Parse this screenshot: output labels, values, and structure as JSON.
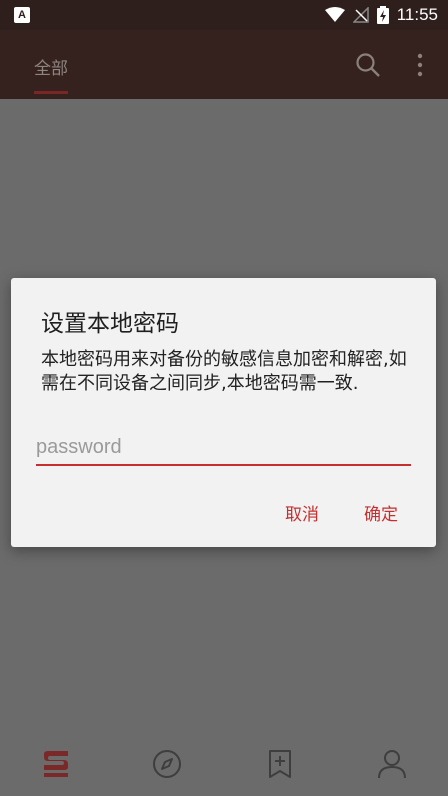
{
  "status_bar": {
    "app_icon_letter": "A",
    "time": "11:55",
    "icons": [
      "wifi-icon",
      "no-signal-icon",
      "battery-charging-icon"
    ]
  },
  "app_bar": {
    "tab_label": "全部",
    "icons": [
      "search-icon",
      "more-vert-icon"
    ]
  },
  "dialog": {
    "title": "设置本地密码",
    "message": "本地密码用来对备份的敏感信息加密和解密,如需在不同设备之间同步,本地密码需一致.",
    "input_placeholder": "password",
    "input_value": "",
    "cancel_label": "取消",
    "ok_label": "确定"
  },
  "bottom_nav": {
    "items": [
      "subscriptions-icon",
      "compass-icon",
      "bookmark-add-icon",
      "profile-icon"
    ]
  },
  "colors": {
    "accent": "#c62f2f",
    "app_bar": "#35221e",
    "dim_overlay": "#6b6b6b",
    "dialog_bg": "#f2f2f2"
  }
}
